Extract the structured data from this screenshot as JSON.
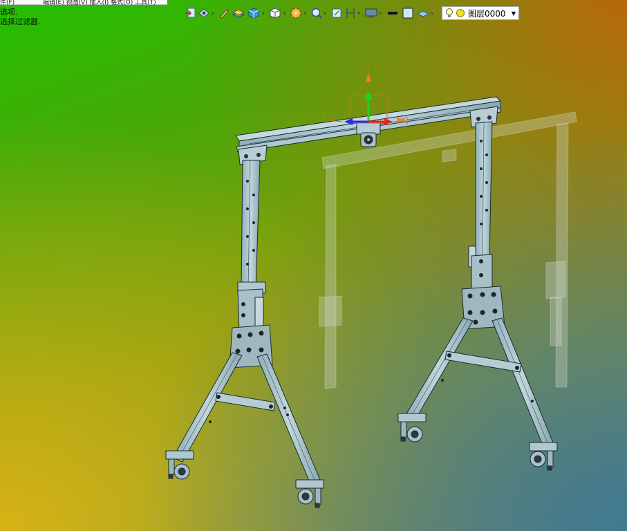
{
  "title_fragments": [
    "件(F)",
    "编辑(E) 视图(V) 插入(I) 格式(O) 工具(T)"
  ],
  "prompt_lines": [
    "选项.",
    "选择过滤器."
  ],
  "toolbar": {
    "items": [
      {
        "name": "ucs-icon",
        "dropdown": false
      },
      {
        "name": "view-icon",
        "dropdown": true
      },
      {
        "name": "pen-icon",
        "dropdown": false
      },
      {
        "name": "layer-tool-icon",
        "dropdown": false
      },
      {
        "name": "cube-icon",
        "dropdown": true
      },
      {
        "name": "box-icon",
        "dropdown": true
      },
      {
        "name": "visual-style-icon",
        "dropdown": true
      },
      {
        "name": "zoom-icon",
        "dropdown": true
      },
      {
        "name": "fit-icon",
        "dropdown": false
      },
      {
        "name": "dimension-icon",
        "dropdown": true
      },
      {
        "name": "display-icon",
        "dropdown": true
      },
      {
        "name": "lineweight-icon",
        "dropdown": false
      },
      {
        "name": "color-swatch-icon",
        "dropdown": false
      },
      {
        "name": "layer-props-icon",
        "dropdown": true
      }
    ],
    "layer_name": "图层0000",
    "dropdown_glyph": "▼"
  },
  "gizmo": {
    "y_label": "Y",
    "z_label": "Z",
    "x_label": "X"
  },
  "colors": {
    "beam": "#a8c4cc",
    "edge": "#1a2a30",
    "ghost": "rgba(200,215,210,0.45)",
    "gizmo_y": "#1fd41f",
    "gizmo_x": "#ee2020",
    "gizmo_z": "#2030ee",
    "gizmo_frame": "#d07020"
  }
}
